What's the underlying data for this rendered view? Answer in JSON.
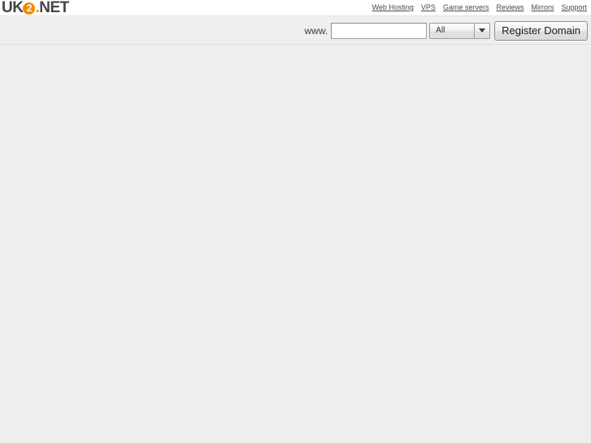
{
  "brand": {
    "logo_prefix": "UK",
    "logo_circle": "2",
    "logo_dot": ".",
    "logo_suffix": "NET",
    "logo_alt": "UK2.NET",
    "accent_color": "#f08c0c",
    "text_color": "#44444a"
  },
  "nav": {
    "items": [
      {
        "label": "Web Hosting"
      },
      {
        "label": "VPS"
      },
      {
        "label": "Game servers"
      },
      {
        "label": "Reviews"
      },
      {
        "label": "Mirrors"
      },
      {
        "label": "Support"
      }
    ]
  },
  "search": {
    "prefix_label": "www.",
    "domain_value": "",
    "domain_placeholder": "",
    "tld_selected": "All",
    "tld_options": [
      "All"
    ],
    "submit_label": "Register Domain"
  },
  "body": {
    "content": ""
  }
}
